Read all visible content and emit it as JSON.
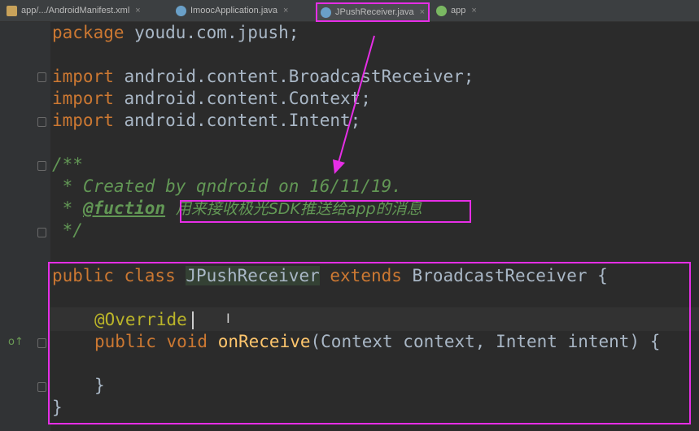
{
  "tabs": [
    {
      "label": "app/.../AndroidManifest.xml",
      "icon": "manifest-icon"
    },
    {
      "label": "ImoocApplication.java",
      "icon": "class-icon"
    },
    {
      "label": "JPushReceiver.java",
      "icon": "class-icon"
    },
    {
      "label": "app",
      "icon": "android-icon"
    }
  ],
  "code": {
    "package_kw": "package",
    "package_name": " youdu.com.jpush;",
    "imports": [
      {
        "kw": "import",
        "name": " android.content.BroadcastReceiver;"
      },
      {
        "kw": "import",
        "name": " android.content.Context;"
      },
      {
        "kw": "import",
        "name": " android.content.Intent;"
      }
    ],
    "doc_open": "/**",
    "doc_created": " * Created by qndroid on 16/11/19.",
    "doc_star": " * ",
    "doc_tag": "@fuction",
    "doc_desc": "用来接收极光SDK推送给app的消息",
    "doc_close": " */",
    "class_public": "public class ",
    "class_name": "JPushReceiver",
    "class_extends": " extends ",
    "class_super": "BroadcastReceiver {",
    "override": "@Override",
    "method_public": "public void ",
    "method_name": "onReceive",
    "method_params": "(Context context, Intent intent) {",
    "method_close": "}",
    "class_close": "}"
  },
  "gutter_marker": "o↑"
}
